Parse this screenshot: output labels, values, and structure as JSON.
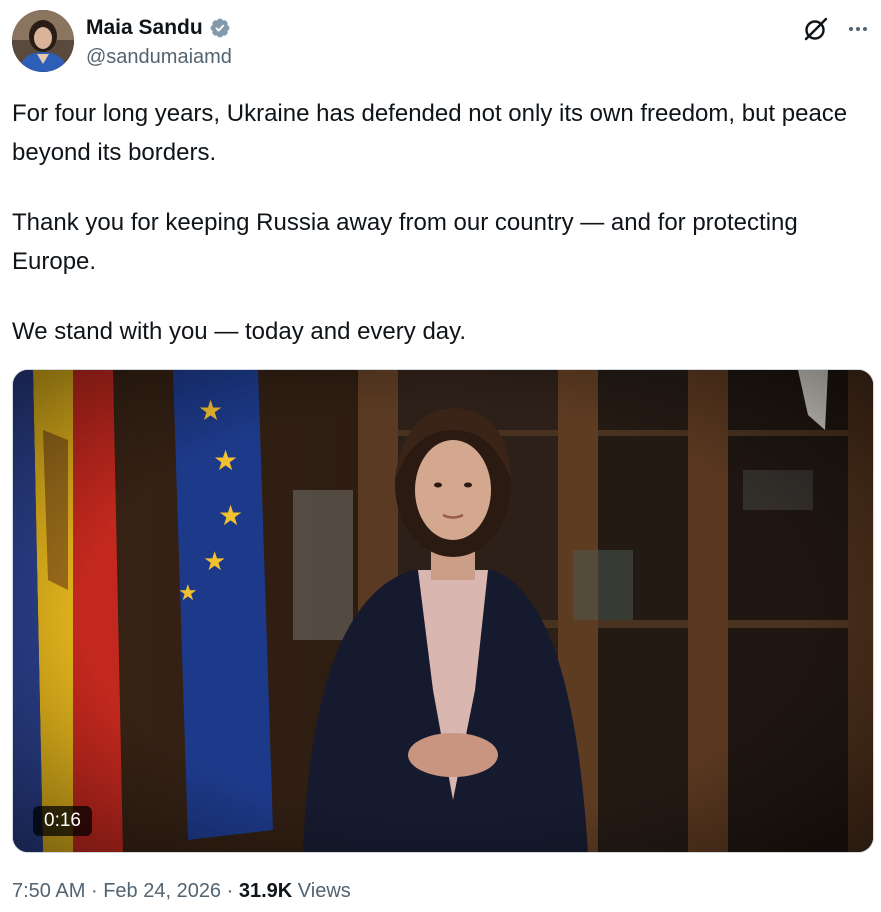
{
  "author": {
    "display_name": "Maia Sandu",
    "handle": "@sandumaiamd",
    "verified": true
  },
  "icons": {
    "verified": "verified-badge-icon",
    "grok": "grok-icon",
    "more": "more-options-icon"
  },
  "tweet": {
    "paragraphs": [
      "For four long years, Ukraine has defended not only its own freedom, but peace beyond its borders.",
      "Thank you for keeping Russia away from our country — and for protecting Europe.",
      "We stand with you — today and every day."
    ]
  },
  "media": {
    "type": "video",
    "duration": "0:16"
  },
  "meta": {
    "time": "7:50 AM",
    "separator": "·",
    "date": "Feb 24, 2026",
    "views_count": "31.9K",
    "views_label": "Views"
  },
  "colors": {
    "text_primary": "#0f1419",
    "text_secondary": "#536471",
    "verified_badge": "#829aab",
    "border": "#cfd9de"
  }
}
